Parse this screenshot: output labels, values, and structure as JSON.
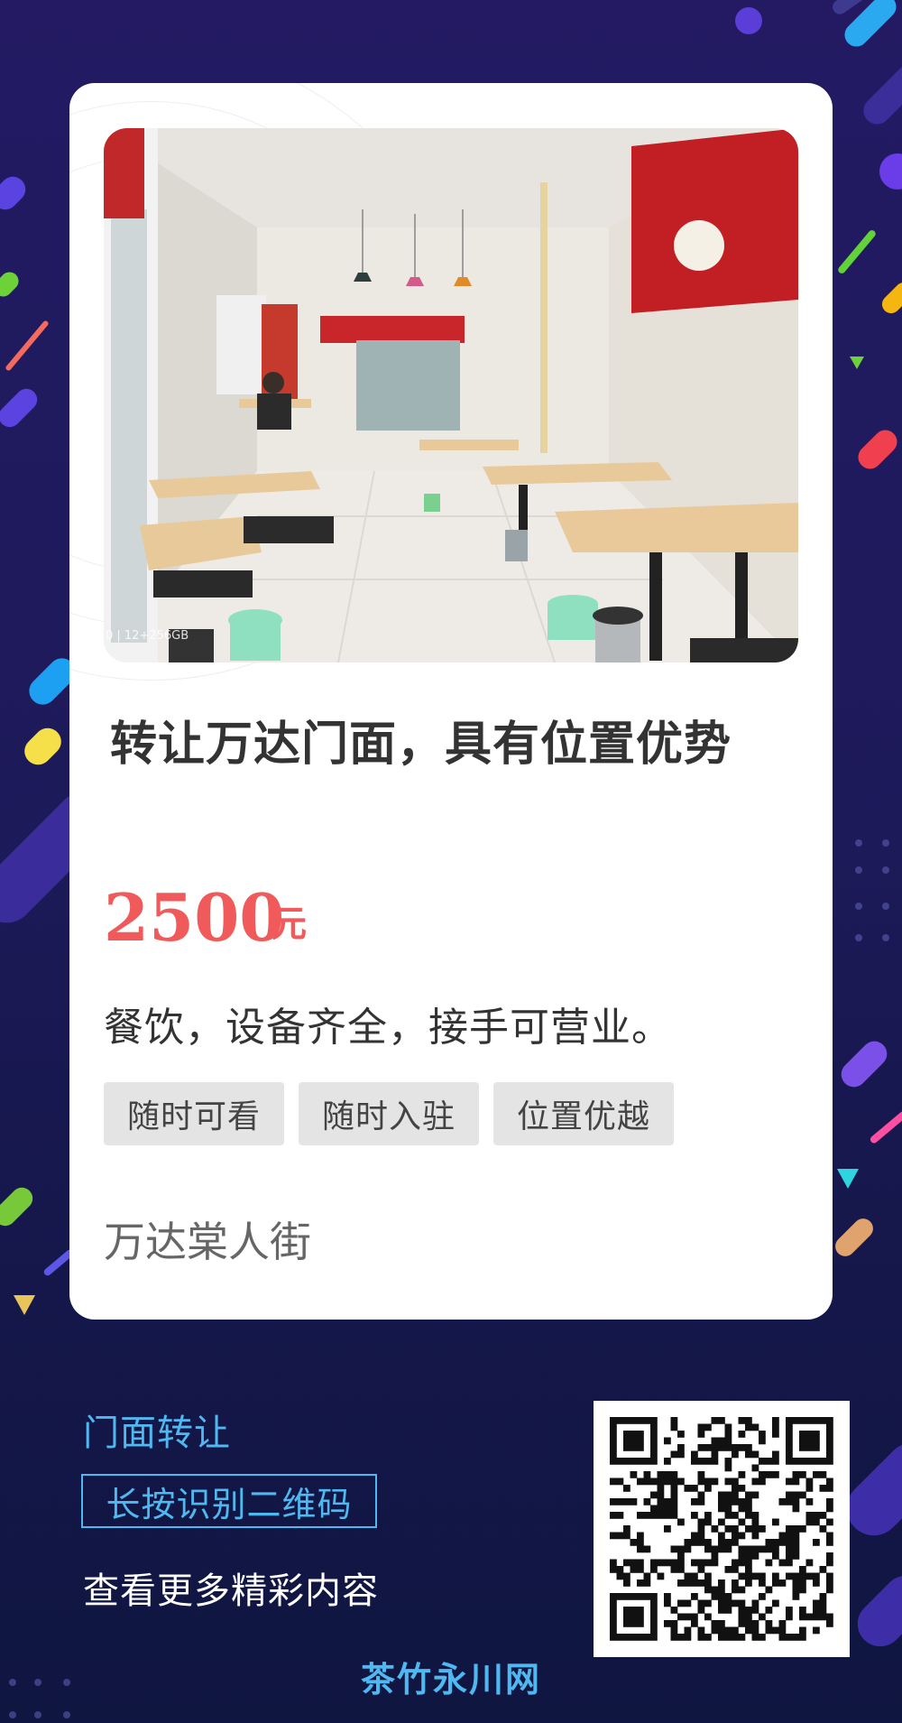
{
  "listing": {
    "title": "转让万达门面，具有位置优势",
    "price": "2500",
    "unit": "元",
    "description": "餐饮，设备齐全，接手可营业。",
    "tags": [
      "随时可看",
      "随时入驻",
      "位置优越"
    ],
    "location": "万达棠人街",
    "photo_stamp": "0 | 12+256GB"
  },
  "footer": {
    "title": "门面转让",
    "button_label": "长按识别二维码",
    "more_text": "查看更多精彩内容",
    "brand": "茶竹永川网"
  },
  "colors": {
    "price": "#f05a5a",
    "accent": "#4fb8f0",
    "background": "#231a63"
  }
}
